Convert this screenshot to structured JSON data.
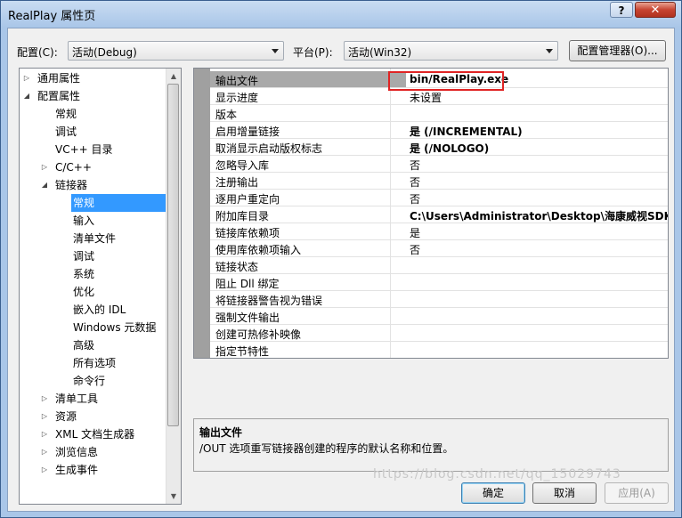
{
  "window": {
    "title": "RealPlay 属性页",
    "help_label": "?",
    "close_label": "✕"
  },
  "toolbar": {
    "config_label": "配置(C):",
    "config_value": "活动(Debug)",
    "platform_label": "平台(P):",
    "platform_value": "活动(Win32)",
    "config_manager_label": "配置管理器(O)..."
  },
  "tree": {
    "items": [
      {
        "label": "通用属性",
        "exp": "▷"
      },
      {
        "label": "配置属性",
        "exp": "◢"
      },
      {
        "label": "常规",
        "exp": ""
      },
      {
        "label": "调试",
        "exp": ""
      },
      {
        "label": "VC++ 目录",
        "exp": ""
      },
      {
        "label": "C/C++",
        "exp": "▷"
      },
      {
        "label": "链接器",
        "exp": "◢"
      },
      {
        "label": "常规",
        "exp": ""
      },
      {
        "label": "输入",
        "exp": ""
      },
      {
        "label": "清单文件",
        "exp": ""
      },
      {
        "label": "调试",
        "exp": ""
      },
      {
        "label": "系统",
        "exp": ""
      },
      {
        "label": "优化",
        "exp": ""
      },
      {
        "label": "嵌入的 IDL",
        "exp": ""
      },
      {
        "label": "Windows 元数据",
        "exp": ""
      },
      {
        "label": "高级",
        "exp": ""
      },
      {
        "label": "所有选项",
        "exp": ""
      },
      {
        "label": "命令行",
        "exp": ""
      },
      {
        "label": "清单工具",
        "exp": "▷"
      },
      {
        "label": "资源",
        "exp": "▷"
      },
      {
        "label": "XML 文档生成器",
        "exp": "▷"
      },
      {
        "label": "浏览信息",
        "exp": "▷"
      },
      {
        "label": "生成事件",
        "exp": "▷"
      }
    ],
    "scroll_up": "▲",
    "scroll_down": "▼"
  },
  "properties": {
    "rows": [
      {
        "name": "输出文件",
        "value": "bin/RealPlay.exe"
      },
      {
        "name": "显示进度",
        "value": "未设置"
      },
      {
        "name": "版本",
        "value": ""
      },
      {
        "name": "启用增量链接",
        "value": "是 (/INCREMENTAL)"
      },
      {
        "name": "取消显示启动版权标志",
        "value": "是 (/NOLOGO)"
      },
      {
        "name": "忽略导入库",
        "value": "否"
      },
      {
        "name": "注册输出",
        "value": "否"
      },
      {
        "name": "逐用户重定向",
        "value": "否"
      },
      {
        "name": "附加库目录",
        "value": "C:\\Users\\Administrator\\Desktop\\海康威视SDK\\CH-"
      },
      {
        "name": "链接库依赖项",
        "value": "是"
      },
      {
        "name": "使用库依赖项输入",
        "value": "否"
      },
      {
        "name": "链接状态",
        "value": ""
      },
      {
        "name": "阻止 Dll 绑定",
        "value": ""
      },
      {
        "name": "将链接器警告视为错误",
        "value": ""
      },
      {
        "name": "强制文件输出",
        "value": ""
      },
      {
        "name": "创建可热修补映像",
        "value": ""
      },
      {
        "name": "指定节特性",
        "value": ""
      }
    ]
  },
  "description": {
    "title": "输出文件",
    "text": "/OUT 选项重写链接器创建的程序的默认名称和位置。"
  },
  "buttons": {
    "ok": "确定",
    "cancel": "取消",
    "apply": "应用(A)"
  },
  "watermark": "https://blog.csdn.net/qq_15029743"
}
